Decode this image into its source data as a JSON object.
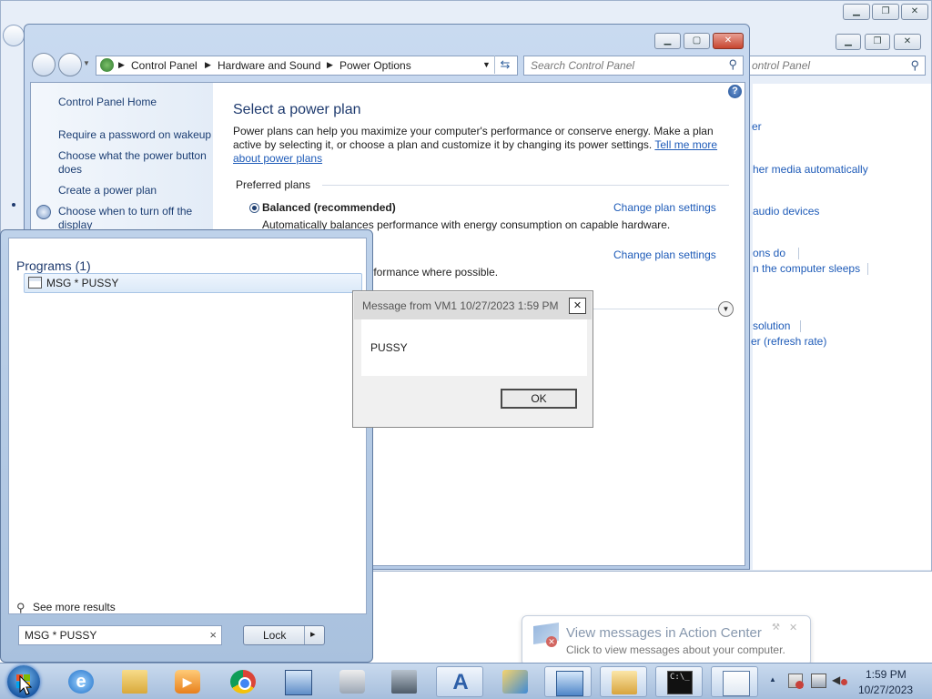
{
  "background_window": {
    "search_placeholder": "ontrol Panel",
    "links": [
      "er",
      "her media automatically",
      "audio devices",
      "ons do",
      "n the computer sleeps",
      "solution",
      "er (refresh rate)"
    ]
  },
  "control_panel": {
    "breadcrumb": [
      "Control Panel",
      "Hardware and Sound",
      "Power Options"
    ],
    "search_placeholder": "Search Control Panel",
    "nav": {
      "home": "Control Panel Home",
      "links": [
        "Require a password on wakeup",
        "Choose what the power button does",
        "Create a power plan",
        "Choose when to turn off the display"
      ]
    },
    "heading": "Select a power plan",
    "intro": "Power plans can help you maximize your computer's performance or conserve energy. Make a plan active by selecting it, or choose a plan and customize it by changing its power settings.",
    "intro_link": "Tell me more about power plans",
    "preferred_plans_label": "Preferred plans",
    "plans": [
      {
        "name": "Balanced (recommended)",
        "description": "Automatically balances performance with energy consumption on capable hardware.",
        "change_link": "Change plan settings",
        "selected": true
      },
      {
        "name": "",
        "description": "ng your computer's performance where possible.",
        "change_link": "Change plan settings",
        "selected": false
      }
    ]
  },
  "start_menu": {
    "programs_header": "Programs (1)",
    "result": "MSG * PUSSY",
    "see_more": "See more results",
    "search_value": "MSG * PUSSY",
    "clear_glyph": "×",
    "lock_label": "Lock",
    "lock_arrow": "▸"
  },
  "message_dialog": {
    "title": "Message from VM1 10/27/2023 1:59 PM",
    "close_glyph": "✕",
    "message": "PUSSY",
    "ok_label": "OK"
  },
  "action_center": {
    "title": "View messages in Action Center",
    "subtitle": "Click to view messages about your computer.",
    "close_glyph": "✕"
  },
  "taskbar": {
    "time": "1:59 PM",
    "date": "10/27/2023",
    "tray_arrow": "▲",
    "apps": [
      "internet-explorer",
      "file-explorer",
      "media-player",
      "chrome",
      "remote-desktop",
      "control-panel-tools",
      "server-manager",
      "active-directory",
      "network-tools",
      "performance-monitor",
      "folders",
      "command-prompt",
      "notepad"
    ]
  },
  "colors": {
    "link": "#1e5bb8",
    "nav_link": "#1c3e73",
    "heading": "#1e3a6e",
    "close_red": "#c7452f"
  }
}
